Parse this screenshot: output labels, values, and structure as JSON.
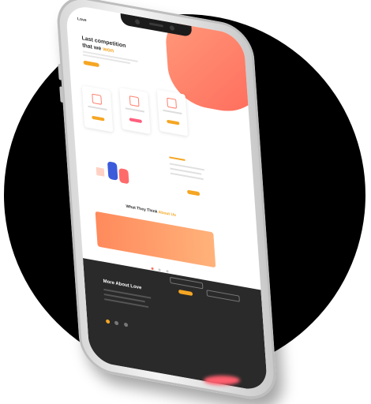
{
  "colors": {
    "accent": "#f5a623",
    "coral": "#ff6a5b",
    "pink": "#ff5f7e",
    "dark_section": "#2a2a2a",
    "background_circle": "#000000"
  },
  "screen": {
    "brand": "Love",
    "hero": {
      "title_part1": "Last competition",
      "title_part2": "that we",
      "title_accent": "won"
    },
    "testimonials": {
      "title": "What They Think",
      "title_accent": "About Us"
    },
    "about_dark": {
      "title": "More About Love"
    }
  }
}
